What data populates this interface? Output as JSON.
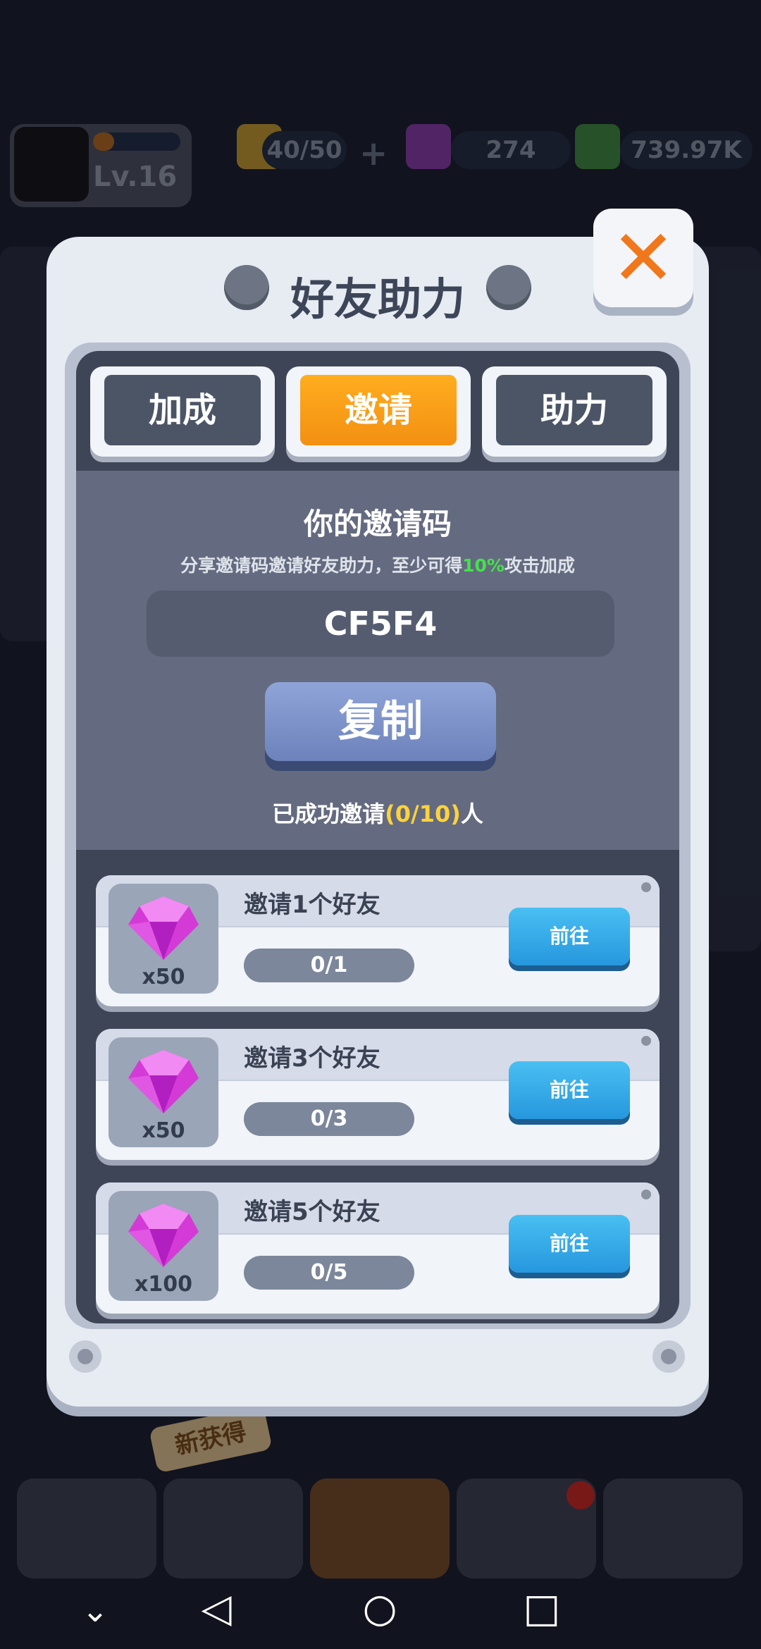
{
  "hud": {
    "level": "Lv.16",
    "energy": "40/50",
    "gems": "274",
    "cash": "739.97K"
  },
  "modal": {
    "title": "好友助力",
    "tabs": [
      {
        "label": "加成",
        "active": false
      },
      {
        "label": "邀请",
        "active": true
      },
      {
        "label": "助力",
        "active": false
      }
    ],
    "invite": {
      "heading": "你的邀请码",
      "subtitle_prefix": "分享邀请码邀请好友助力，至少可得",
      "subtitle_pct": "10%",
      "subtitle_suffix": "攻击加成",
      "code": "CF5F4",
      "copy_label": "复制",
      "count_prefix": "已成功邀请",
      "count_value": "(0/10)",
      "count_suffix": "人"
    },
    "rewards": [
      {
        "label": "邀请1个好友",
        "qty": "x50",
        "progress": "0/1",
        "button": "前往"
      },
      {
        "label": "邀请3个好友",
        "qty": "x50",
        "progress": "0/3",
        "button": "前往"
      },
      {
        "label": "邀请5个好友",
        "qty": "x100",
        "progress": "0/5",
        "button": "前往"
      }
    ]
  },
  "bottom": {
    "new_badge": "新获得"
  },
  "colors": {
    "accent_orange": "#F39012",
    "button_blue": "#2697DE",
    "highlight_green": "#45E14D",
    "highlight_yellow": "#FFD23A"
  }
}
